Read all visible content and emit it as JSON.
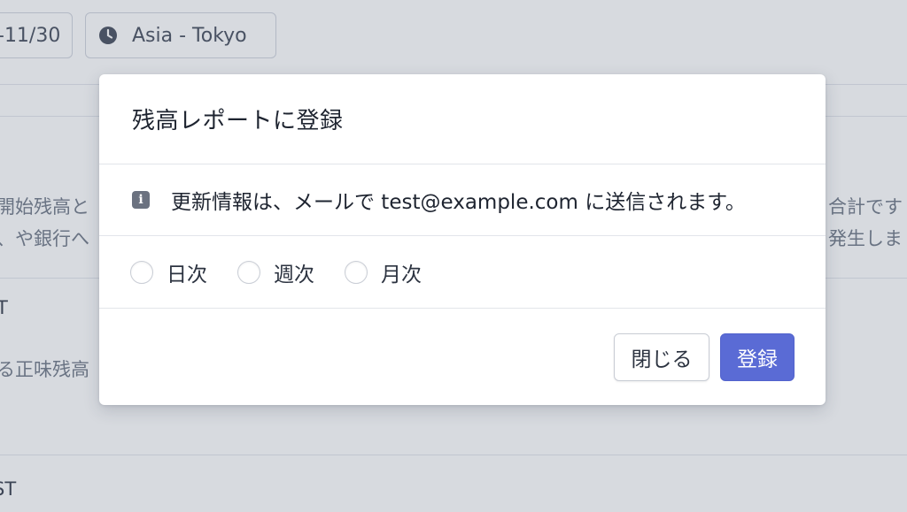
{
  "background": {
    "date_chip": "-11/30",
    "timezone_chip": "Asia - Tokyo",
    "text_left_1": "開始残高と",
    "text_left_2": "、や銀行へ",
    "text_right_1": "合計です",
    "text_right_2": "発生しま",
    "section_label_1": "T",
    "text_left_3": "る正味残高",
    "section_label_2": "ST"
  },
  "modal": {
    "title": "残高レポートに登録",
    "info_text": "更新情報は、メールで test@example.com に送信されます。",
    "options": [
      {
        "label": "日次",
        "selected": false
      },
      {
        "label": "週次",
        "selected": false
      },
      {
        "label": "月次",
        "selected": false
      }
    ],
    "close_label": "閉じる",
    "submit_label": "登録"
  },
  "colors": {
    "accent": "#5a6bd5",
    "overlay": "#4b556e"
  },
  "icons": {
    "info": "info-icon",
    "timezone": "clock-icon"
  }
}
